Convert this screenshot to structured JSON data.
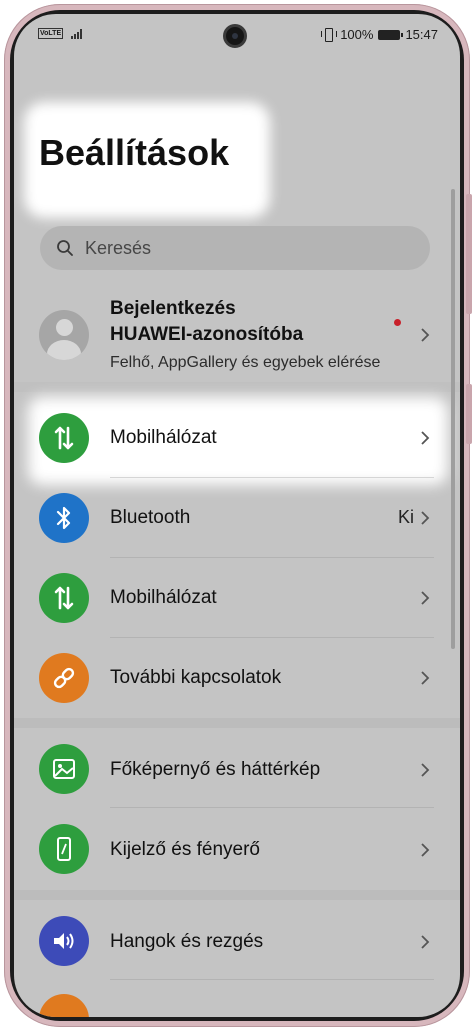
{
  "status_bar": {
    "volte": "VoLTE",
    "battery_percent": "100%",
    "time": "15:47"
  },
  "page": {
    "title": "Beállítások"
  },
  "search": {
    "placeholder": "Keresés"
  },
  "account": {
    "line1": "Bejelentkezés",
    "line2": "HUAWEI-azonosítóba",
    "subtitle": "Felhő, AppGallery és egyebek elérése"
  },
  "items": [
    {
      "label": "Mobilhálózat",
      "icon": "mobile-data-icon",
      "color": "#2e9e3e",
      "value": ""
    },
    {
      "label": "Bluetooth",
      "icon": "bluetooth-icon",
      "color": "#1f73c8",
      "value": "Ki"
    },
    {
      "label": "Mobilhálózat",
      "icon": "mobile-data-icon",
      "color": "#2e9e3e",
      "value": ""
    },
    {
      "label": "További kapcsolatok",
      "icon": "link-icon",
      "color": "#e07a1f",
      "value": ""
    },
    {
      "label": "Főképernyő és háttérkép",
      "icon": "wallpaper-icon",
      "color": "#2e9e3e",
      "value": ""
    },
    {
      "label": "Kijelző és fényerő",
      "icon": "display-icon",
      "color": "#2e9e3e",
      "value": ""
    },
    {
      "label": "Hangok és rezgés",
      "icon": "volume-icon",
      "color": "#3d4bb8",
      "value": ""
    }
  ],
  "colors": {
    "highlight": "#ffffff",
    "dim_overlay": "#c4c4c4"
  }
}
